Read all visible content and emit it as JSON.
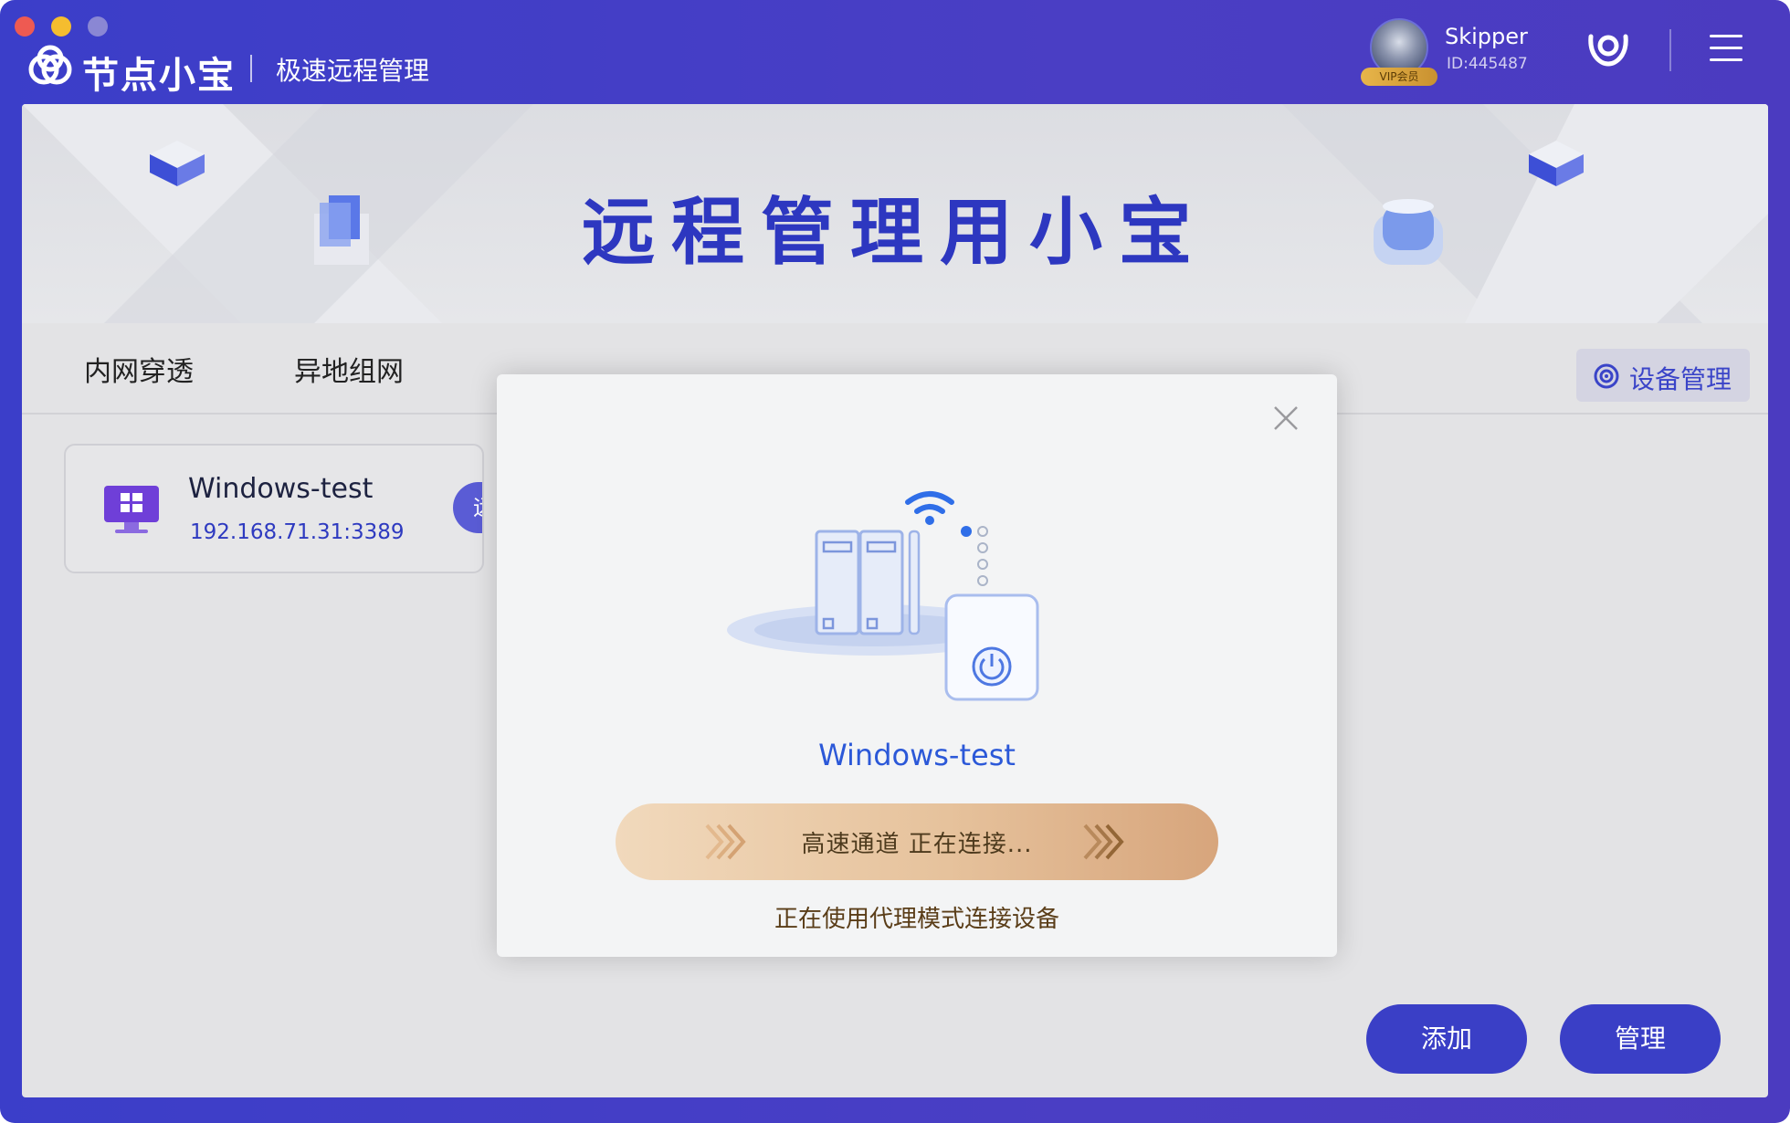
{
  "window": {
    "app_name": "节点小宝",
    "subtitle": "极速远程管理"
  },
  "user": {
    "name": "Skipper",
    "id": "ID:445487",
    "vip_badge": "VIP会员"
  },
  "banner": {
    "title": "远程管理用小宝"
  },
  "tabs": [
    {
      "label": "内网穿透"
    },
    {
      "label": "异地组网"
    }
  ],
  "device_management_label": "设备管理",
  "device_card": {
    "name": "Windows-test",
    "address": "192.168.71.31:3389",
    "remote_button": "远"
  },
  "modal": {
    "device_name": "Windows-test",
    "progress_text": "高速通道  正在连接...",
    "status_text": "正在使用代理模式连接设备"
  },
  "buttons": {
    "add": "添加",
    "manage": "管理"
  },
  "colors": {
    "header_bg": "#4a3ec4",
    "accent": "#3a3fc6",
    "progress_start": "#f1d9bc",
    "progress_end": "#d7a57c"
  }
}
